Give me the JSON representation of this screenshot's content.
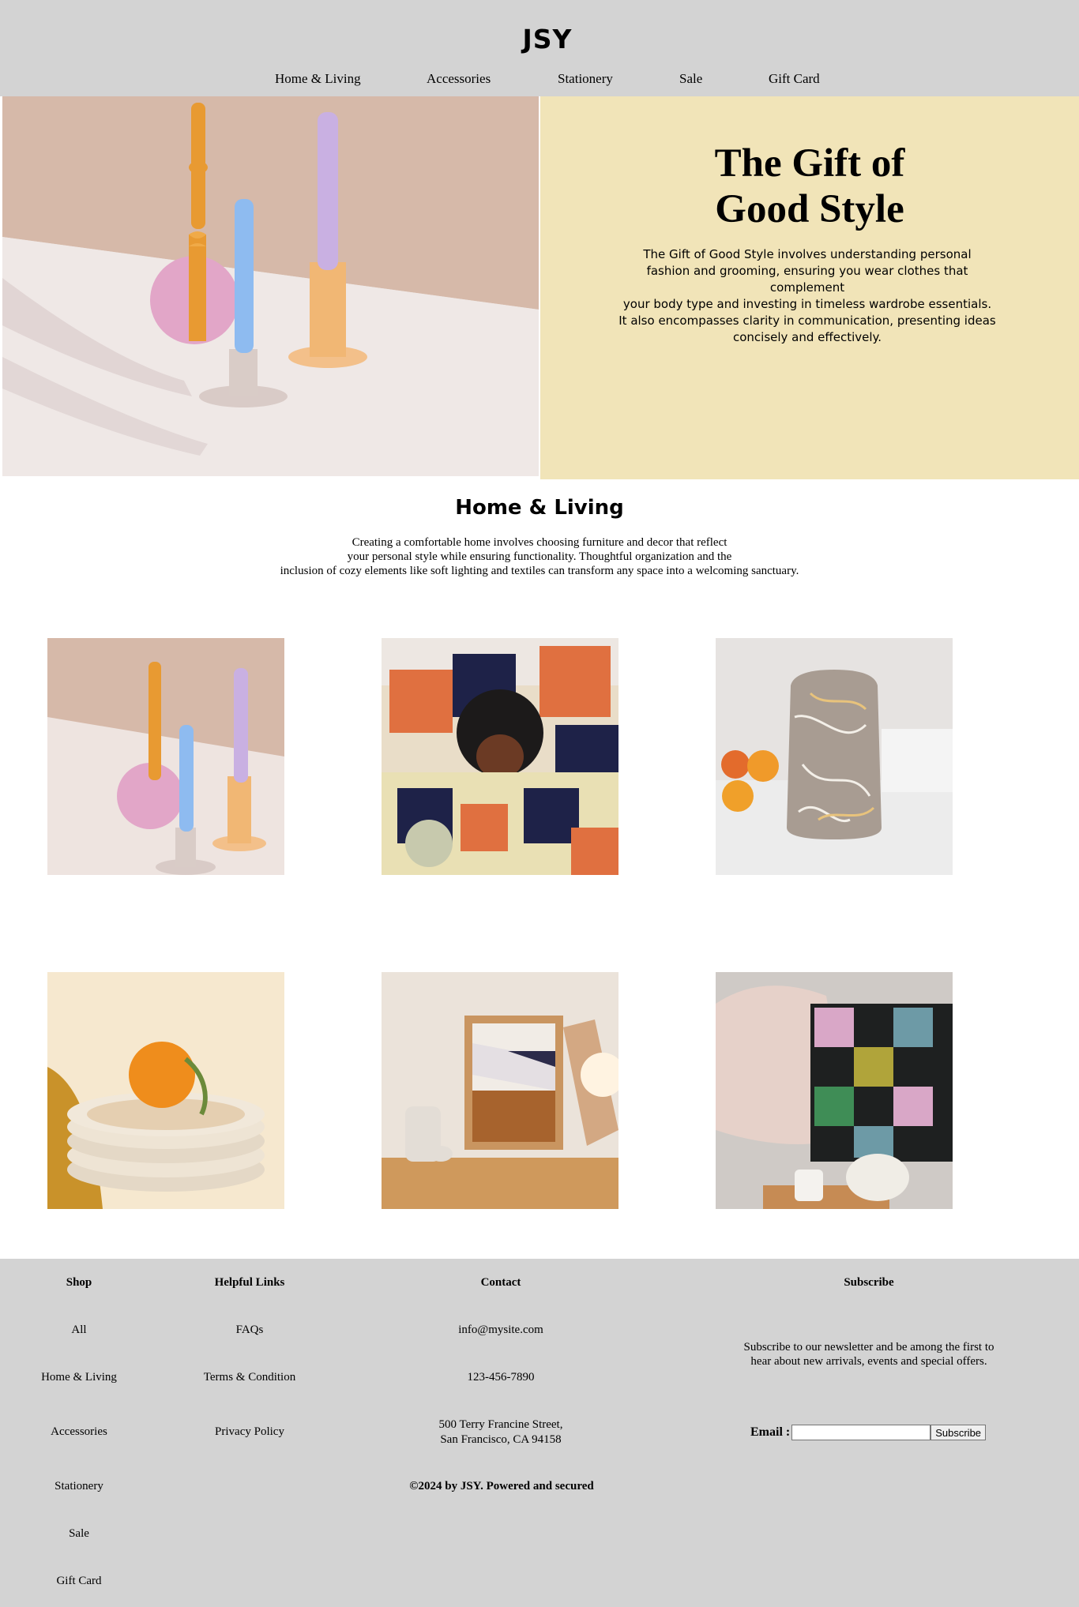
{
  "header": {
    "brand": "JSY",
    "nav": [
      "Home & Living",
      "Accessories",
      "Stationery",
      "Sale",
      "Gift Card"
    ]
  },
  "hero": {
    "title_line1": "The Gift of",
    "title_line2": "Good Style",
    "text_lines": [
      "The Gift of Good Style involves understanding personal",
      "fashion and grooming, ensuring you wear clothes that complement",
      "your body type and investing in timeless wardrobe essentials.",
      "It also encompasses clarity in communication, presenting ideas",
      "concisely and effectively."
    ]
  },
  "section": {
    "title": "Home & Living",
    "text_lines": [
      "Creating a comfortable home involves choosing furniture and decor that reflect",
      "your personal style while ensuring functionality. Thoughtful organization and the",
      "inclusion of cozy elements like soft lighting and textiles can transform any space into a welcoming sanctuary."
    ]
  },
  "footer": {
    "shop": {
      "heading": "Shop",
      "items": [
        "All",
        "Home & Living",
        "Accessories",
        "Stationery",
        "Sale",
        "Gift Card"
      ]
    },
    "helpful": {
      "heading": "Helpful Links",
      "items": [
        "FAQs",
        "Terms & Condition",
        "Privacy Policy"
      ]
    },
    "contact": {
      "heading": "Contact",
      "email": "info@mysite.com",
      "phone": "123-456-7890",
      "address_line1": "500 Terry Francine Street,",
      "address_line2": "San Francisco, CA 94158"
    },
    "subscribe": {
      "heading": "Subscribe",
      "text_line1": "Subscribe to our newsletter and be among the first to",
      "text_line2": "hear about new arrivals, events and special offers.",
      "email_label": "Email :",
      "email_value": "",
      "button": "Subscribe"
    },
    "copyright": "©2024 by JSY. Powered and secured"
  },
  "colors": {
    "header_bg": "#d3d3d3",
    "hero_panel_bg": "#f1e4b8",
    "footer_bg": "#d3d3d3"
  }
}
